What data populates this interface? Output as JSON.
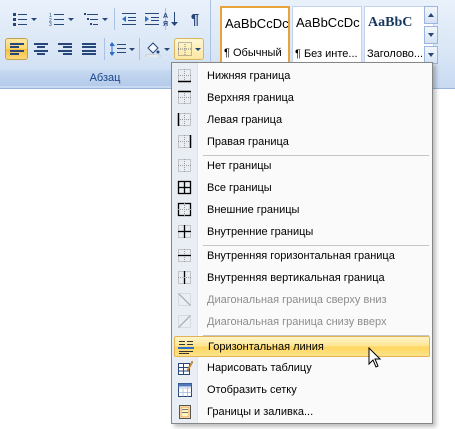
{
  "ribbon": {
    "group_label": "Абзац",
    "colors": {
      "ribbon_bg": "#dbe7f6",
      "active_button": "#fbd56b",
      "group_border": "#a9c1e2"
    },
    "buttons_row1": [
      {
        "name": "bullets-button",
        "icon": "bullets-icon"
      },
      {
        "name": "numbering-button",
        "icon": "numbering-icon"
      },
      {
        "name": "multilevel-list-button",
        "icon": "multilevel-list-icon"
      },
      {
        "name": "decrease-indent-button",
        "icon": "decrease-indent-icon"
      },
      {
        "name": "increase-indent-button",
        "icon": "increase-indent-icon"
      },
      {
        "name": "sort-button",
        "icon": "sort-az-icon"
      },
      {
        "name": "show-formatting-button",
        "icon": "pilcrow-icon"
      }
    ],
    "buttons_row2": [
      {
        "name": "align-left-button",
        "icon": "align-left-icon",
        "active": true
      },
      {
        "name": "align-center-button",
        "icon": "align-center-icon"
      },
      {
        "name": "align-right-button",
        "icon": "align-right-icon"
      },
      {
        "name": "justify-button",
        "icon": "justify-icon"
      },
      {
        "name": "line-spacing-button",
        "icon": "line-spacing-icon"
      },
      {
        "name": "shading-button",
        "icon": "paint-bucket-icon"
      },
      {
        "name": "borders-button",
        "icon": "border-grid-icon",
        "hover": true
      }
    ]
  },
  "gallery": {
    "styles": [
      {
        "sample": "AaBbCcDc",
        "name": "¶ Обычный",
        "selected": true
      },
      {
        "sample": "AaBbCcDc",
        "name": "¶ Без инте..."
      },
      {
        "sample": "AaBbC",
        "name": "Заголово..."
      }
    ]
  },
  "menu": {
    "items": [
      {
        "label": "Нижняя граница",
        "icon": "bottom-border-icon",
        "enabled": true
      },
      {
        "label": "Верхняя граница",
        "icon": "top-border-icon",
        "enabled": true
      },
      {
        "label": "Левая граница",
        "icon": "left-border-icon",
        "enabled": true
      },
      {
        "label": "Правая граница",
        "icon": "right-border-icon",
        "enabled": true
      },
      {
        "label": "Нет границы",
        "icon": "no-border-icon",
        "enabled": true
      },
      {
        "label": "Все границы",
        "icon": "all-borders-icon",
        "enabled": true
      },
      {
        "label": "Внешние границы",
        "icon": "outside-borders-icon",
        "enabled": true
      },
      {
        "label": "Внутренние границы",
        "icon": "inside-borders-icon",
        "enabled": true
      },
      {
        "label": "Внутренняя горизонтальная граница",
        "icon": "inside-horizontal-border-icon",
        "enabled": true
      },
      {
        "label": "Внутренняя вертикальная граница",
        "icon": "inside-vertical-border-icon",
        "enabled": true
      },
      {
        "label": "Диагональная граница сверху вниз",
        "icon": "diagonal-down-border-icon",
        "enabled": false
      },
      {
        "label": "Диагональная граница снизу вверх",
        "icon": "diagonal-up-border-icon",
        "enabled": false
      },
      {
        "label": "Горизонтальная линия",
        "icon": "horizontal-line-icon",
        "enabled": true,
        "highlighted": true
      },
      {
        "label": "Нарисовать таблицу",
        "icon": "draw-table-icon",
        "enabled": true
      },
      {
        "label": "Отобразить сетку",
        "icon": "view-gridlines-icon",
        "enabled": true
      },
      {
        "label": "Границы и заливка...",
        "icon": "borders-and-shading-icon",
        "enabled": true
      }
    ]
  }
}
